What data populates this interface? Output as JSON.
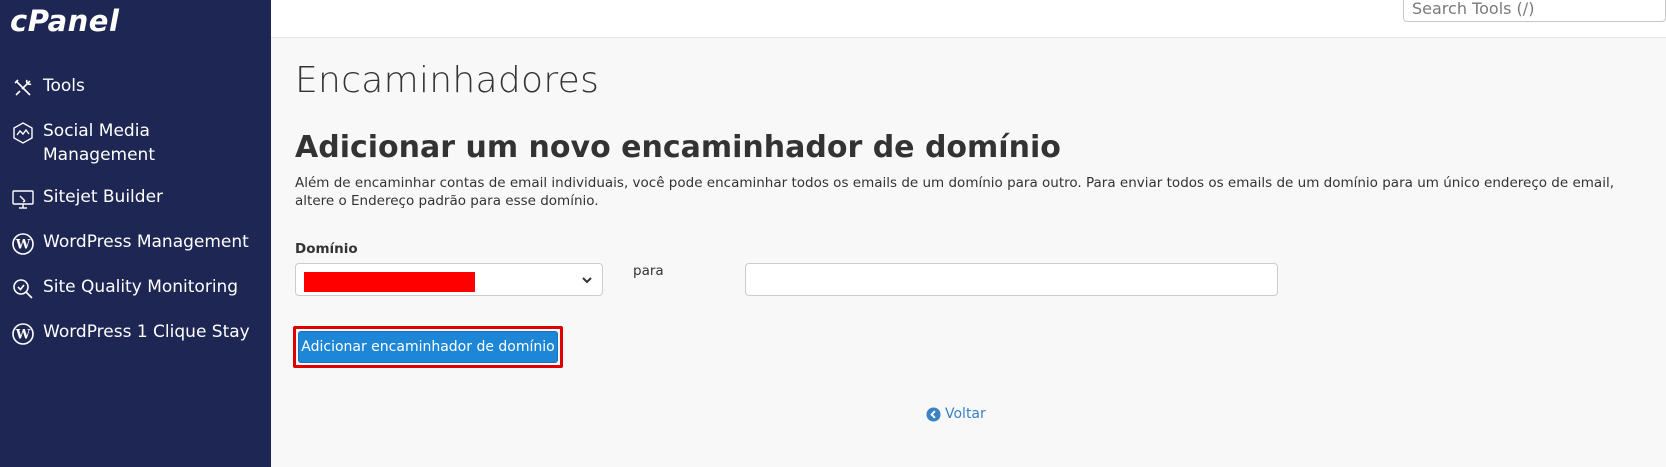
{
  "app": {
    "logo": "cPanel"
  },
  "sidebar": {
    "items": [
      {
        "label": "Tools",
        "icon": "tools-icon"
      },
      {
        "label": "Social Media Management",
        "icon": "social-media-icon"
      },
      {
        "label": "Sitejet Builder",
        "icon": "sitejet-icon"
      },
      {
        "label": "WordPress Management",
        "icon": "wordpress-icon"
      },
      {
        "label": "Site Quality Monitoring",
        "icon": "site-quality-icon"
      },
      {
        "label": "WordPress 1 Clique Stay",
        "icon": "wordpress-icon"
      }
    ]
  },
  "search": {
    "placeholder": "Search Tools (/)",
    "value": ""
  },
  "main": {
    "page_title": "Encaminhadores",
    "section_title": "Adicionar um novo encaminhador de domínio",
    "description": "Além de encaminhar contas de email individuais, você pode encaminhar todos os emails de um domínio para outro. Para enviar todos os emails de um domínio para um único endereço de email, altere o Endereço padrão para esse domínio.",
    "domain_label": "Domínio",
    "to_label": "para",
    "to_value": "",
    "submit_label": "Adicionar encaminhador de domínio",
    "back_label": "Voltar"
  },
  "colors": {
    "sidebar_bg": "#1e2654",
    "button_bg": "#1e86d6",
    "highlight": "#e00000",
    "link": "#3a82c4",
    "redaction": "#ff0000"
  }
}
